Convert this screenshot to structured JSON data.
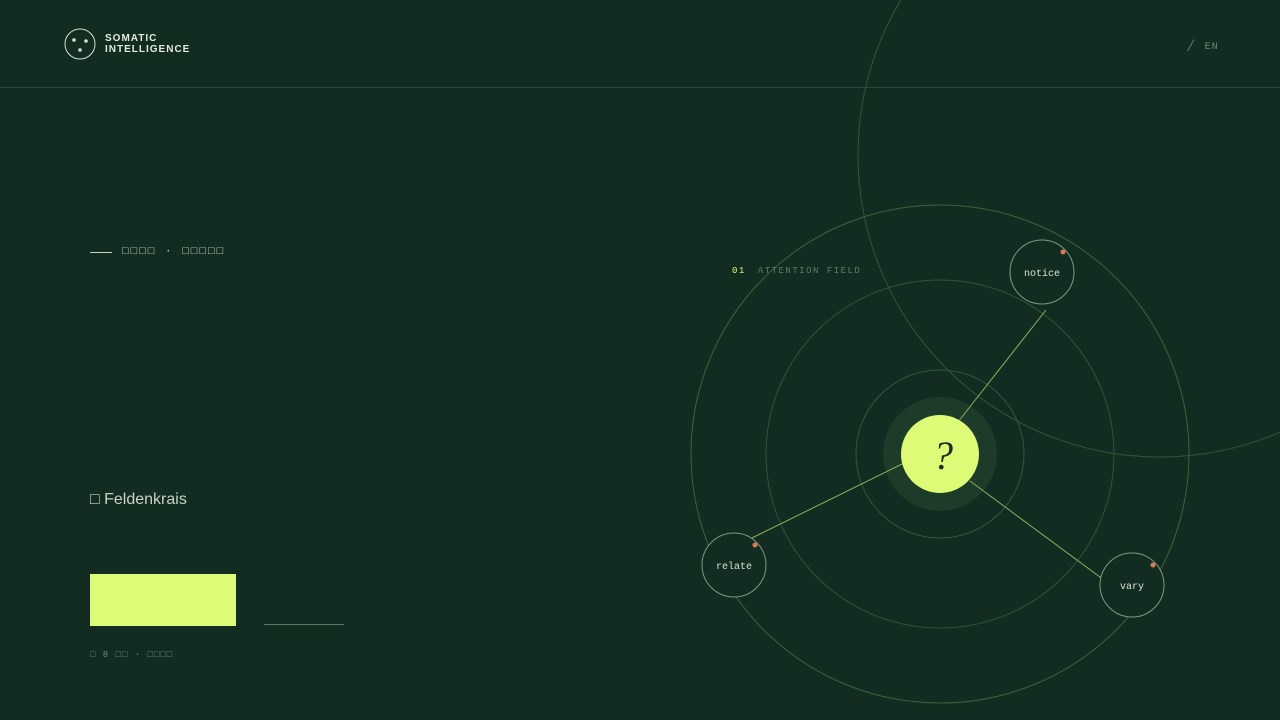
{
  "header": {
    "brand_line1": "SOMATIC",
    "brand_line2": "INTELLIGENCE",
    "lang_separator": "/",
    "lang": "EN"
  },
  "hero": {
    "eyebrow": "□□□□ · □□□□□",
    "method_label": "□ Feldenkrais",
    "meta": "□ 8 □□ · □□□□"
  },
  "diagram": {
    "index": "01",
    "label": "ATTENTION FIELD",
    "center_symbol": "?",
    "nodes": [
      {
        "label": "notice"
      },
      {
        "label": "relate"
      },
      {
        "label": "vary"
      }
    ]
  },
  "colors": {
    "background": "#122c21",
    "accent": "#ddfb76",
    "dot": "#e07a52",
    "ring": "#3f6a3e"
  }
}
